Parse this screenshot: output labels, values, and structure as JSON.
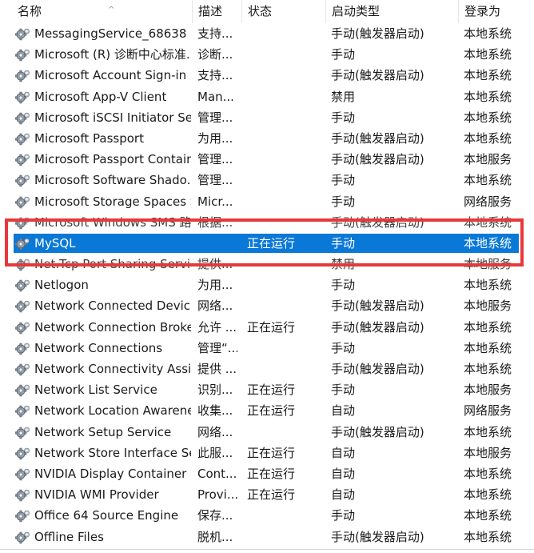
{
  "columns": {
    "name": "名称",
    "description": "描述",
    "status": "状态",
    "startup_type": "启动类型",
    "logon_as": "登录为"
  },
  "rows": [
    {
      "name": "MessagingService_68638",
      "description": "支持...",
      "status": "",
      "startup_type": "手动(触发器启动)",
      "logon_as": "本地系统"
    },
    {
      "name": "Microsoft (R) 诊断中心标准...",
      "description": "诊断...",
      "status": "",
      "startup_type": "手动",
      "logon_as": "本地系统"
    },
    {
      "name": "Microsoft Account Sign-in ...",
      "description": "支持...",
      "status": "",
      "startup_type": "手动(触发器启动)",
      "logon_as": "本地系统"
    },
    {
      "name": "Microsoft App-V Client",
      "description": "Man...",
      "status": "",
      "startup_type": "禁用",
      "logon_as": "本地系统"
    },
    {
      "name": "Microsoft iSCSI Initiator Ser...",
      "description": "管理...",
      "status": "",
      "startup_type": "手动",
      "logon_as": "本地系统"
    },
    {
      "name": "Microsoft Passport",
      "description": "为用...",
      "status": "",
      "startup_type": "手动(触发器启动)",
      "logon_as": "本地系统"
    },
    {
      "name": "Microsoft Passport Container",
      "description": "管理...",
      "status": "",
      "startup_type": "手动(触发器启动)",
      "logon_as": "本地服务"
    },
    {
      "name": "Microsoft Software Shado...",
      "description": "管理...",
      "status": "",
      "startup_type": "手动",
      "logon_as": "本地系统"
    },
    {
      "name": "Microsoft Storage Spaces S...",
      "description": "Micr...",
      "status": "",
      "startup_type": "手动",
      "logon_as": "网络服务"
    },
    {
      "name": "Microsoft Windows SMS 路...",
      "description": "根据...",
      "status": "",
      "startup_type": "手动(触发器启动)",
      "logon_as": "本地系统"
    },
    {
      "name": "MySQL",
      "description": "",
      "status": "正在运行",
      "startup_type": "手动",
      "logon_as": "本地系统"
    },
    {
      "name": "Net.Tcp Port Sharing Service",
      "description": "提供...",
      "status": "",
      "startup_type": "禁用",
      "logon_as": "本地服务"
    },
    {
      "name": "Netlogon",
      "description": "为用...",
      "status": "",
      "startup_type": "手动",
      "logon_as": "本地系统"
    },
    {
      "name": "Network Connected Devic...",
      "description": "网络...",
      "status": "",
      "startup_type": "手动(触发器启动)",
      "logon_as": "本地服务"
    },
    {
      "name": "Network Connection Broker",
      "description": "允许 ...",
      "status": "正在运行",
      "startup_type": "手动(触发器启动)",
      "logon_as": "本地系统"
    },
    {
      "name": "Network Connections",
      "description": "管理“...",
      "status": "",
      "startup_type": "手动",
      "logon_as": "本地系统"
    },
    {
      "name": "Network Connectivity Assis...",
      "description": "提供 ...",
      "status": "",
      "startup_type": "手动(触发器启动)",
      "logon_as": "本地系统"
    },
    {
      "name": "Network List Service",
      "description": "识别...",
      "status": "正在运行",
      "startup_type": "手动",
      "logon_as": "本地服务"
    },
    {
      "name": "Network Location Awarene...",
      "description": "收集...",
      "status": "正在运行",
      "startup_type": "自动",
      "logon_as": "网络服务"
    },
    {
      "name": "Network Setup Service",
      "description": "网络...",
      "status": "",
      "startup_type": "手动(触发器启动)",
      "logon_as": "本地系统"
    },
    {
      "name": "Network Store Interface Se...",
      "description": "此服...",
      "status": "正在运行",
      "startup_type": "自动",
      "logon_as": "本地服务"
    },
    {
      "name": "NVIDIA Display Container LS",
      "description": "Cont...",
      "status": "正在运行",
      "startup_type": "自动",
      "logon_as": "本地系统"
    },
    {
      "name": "NVIDIA WMI Provider",
      "description": "Provi...",
      "status": "正在运行",
      "startup_type": "自动",
      "logon_as": "本地系统"
    },
    {
      "name": "Office 64 Source Engine",
      "description": "保存...",
      "status": "",
      "startup_type": "手动",
      "logon_as": "本地系统"
    },
    {
      "name": "Offline Files",
      "description": "脱机...",
      "status": "",
      "startup_type": "手动(触发器启动)",
      "logon_as": "本地系统"
    }
  ],
  "selected_row_index": 10,
  "colors": {
    "selection": "#0a78d7",
    "highlight_border": "#e8383a"
  },
  "icons": {
    "service": "gear-icon",
    "sort": "sort-ascending-icon"
  }
}
